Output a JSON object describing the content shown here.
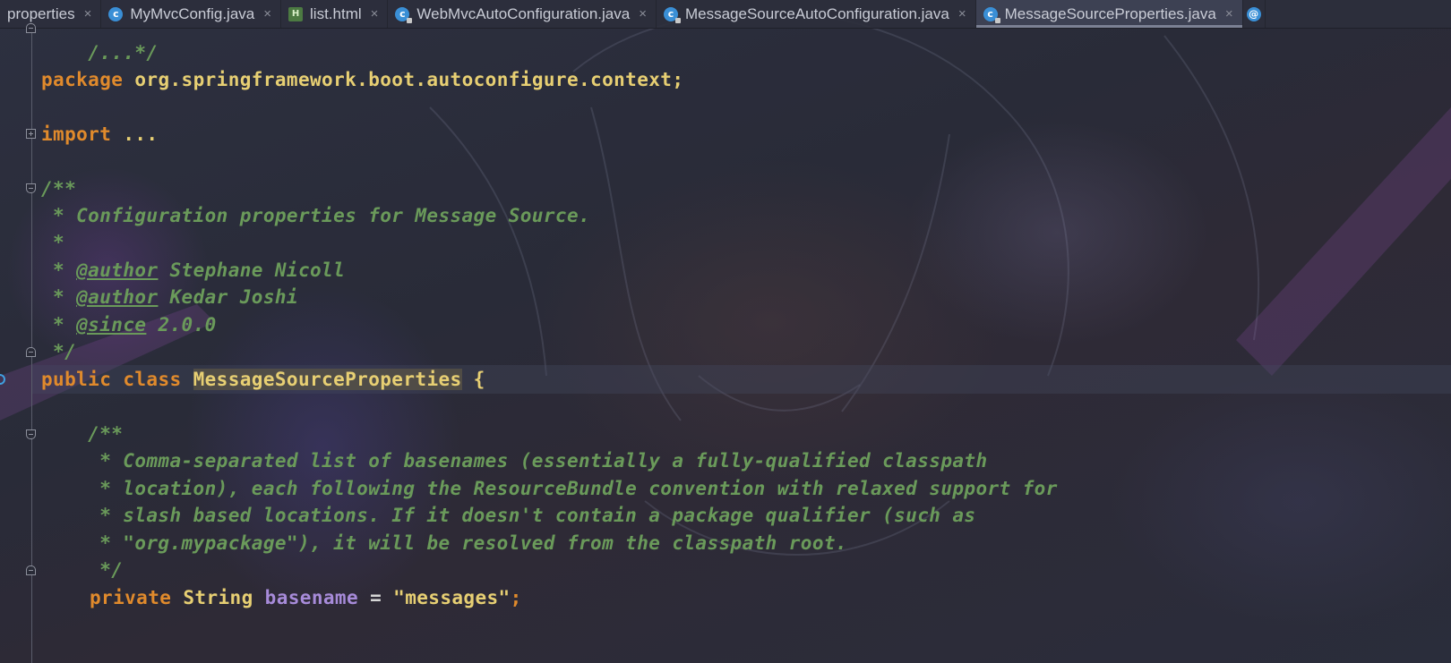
{
  "tabs": [
    {
      "label": "properties",
      "icon": "none",
      "active": false
    },
    {
      "label": "MyMvcConfig.java",
      "icon": "class-icon",
      "active": false
    },
    {
      "label": "list.html",
      "icon": "html-file-icon",
      "active": false
    },
    {
      "label": "WebMvcAutoConfiguration.java",
      "icon": "class-locked-icon",
      "active": false
    },
    {
      "label": "MessageSourceAutoConfiguration.java",
      "icon": "class-locked-icon",
      "active": false
    },
    {
      "label": "MessageSourceProperties.java",
      "icon": "class-locked-icon",
      "active": true
    }
  ],
  "code": {
    "top_fragment": "/...*/",
    "package_kw": "package",
    "package_name": "org.springframework.boot.autoconfigure.context;",
    "import_kw": "import",
    "import_ellipsis": "...",
    "javadoc_open": "/**",
    "class_doc_line1": " * Configuration properties for Message Source.",
    "class_doc_line2": " *",
    "author1_prefix": " * ",
    "author1_tag": "@author",
    "author1_name": " Stephane Nicoll",
    "author2_prefix": " * ",
    "author2_tag": "@author",
    "author2_name": " Kedar Joshi",
    "since_prefix": " * ",
    "since_tag": "@since",
    "since_value": " 2.0.0",
    "javadoc_close": " */",
    "class_public": "public",
    "class_kw": "class",
    "class_name": "MessageSourceProperties",
    "class_brace": "{",
    "field_doc_open": "    /**",
    "field_doc_line1": "     * Comma-separated list of basenames (essentially a fully-qualified classpath",
    "field_doc_line2": "     * location), each following the ResourceBundle convention with relaxed support for",
    "field_doc_line3": "     * slash based locations. If it doesn't contain a package qualifier (such as",
    "field_doc_line4": "     * \"org.mypackage\"), it will be resolved from the classpath root.",
    "field_doc_close": "     */",
    "field_private": "private",
    "field_type": "String",
    "field_name": "basename",
    "field_eq": "=",
    "field_value": "\"messages\"",
    "field_semi": ";"
  }
}
